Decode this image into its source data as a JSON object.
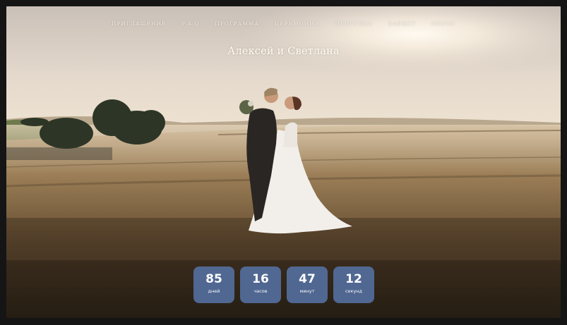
{
  "nav": {
    "items": [
      {
        "label": "Приглашение"
      },
      {
        "label": "F.A.Q"
      },
      {
        "label": "Программа"
      },
      {
        "label": "Церемония"
      },
      {
        "label": "Прогулка"
      },
      {
        "label": "Банкет"
      },
      {
        "label": "Опрос"
      }
    ]
  },
  "hero": {
    "title": "Алексей и Светлана"
  },
  "countdown": [
    {
      "value": "85",
      "unit": "дней"
    },
    {
      "value": "16",
      "unit": "часов"
    },
    {
      "value": "47",
      "unit": "минут"
    },
    {
      "value": "12",
      "unit": "секунд"
    }
  ],
  "colors": {
    "countdown_bg": "#5876ad",
    "text_light": "#f5f0e8"
  }
}
